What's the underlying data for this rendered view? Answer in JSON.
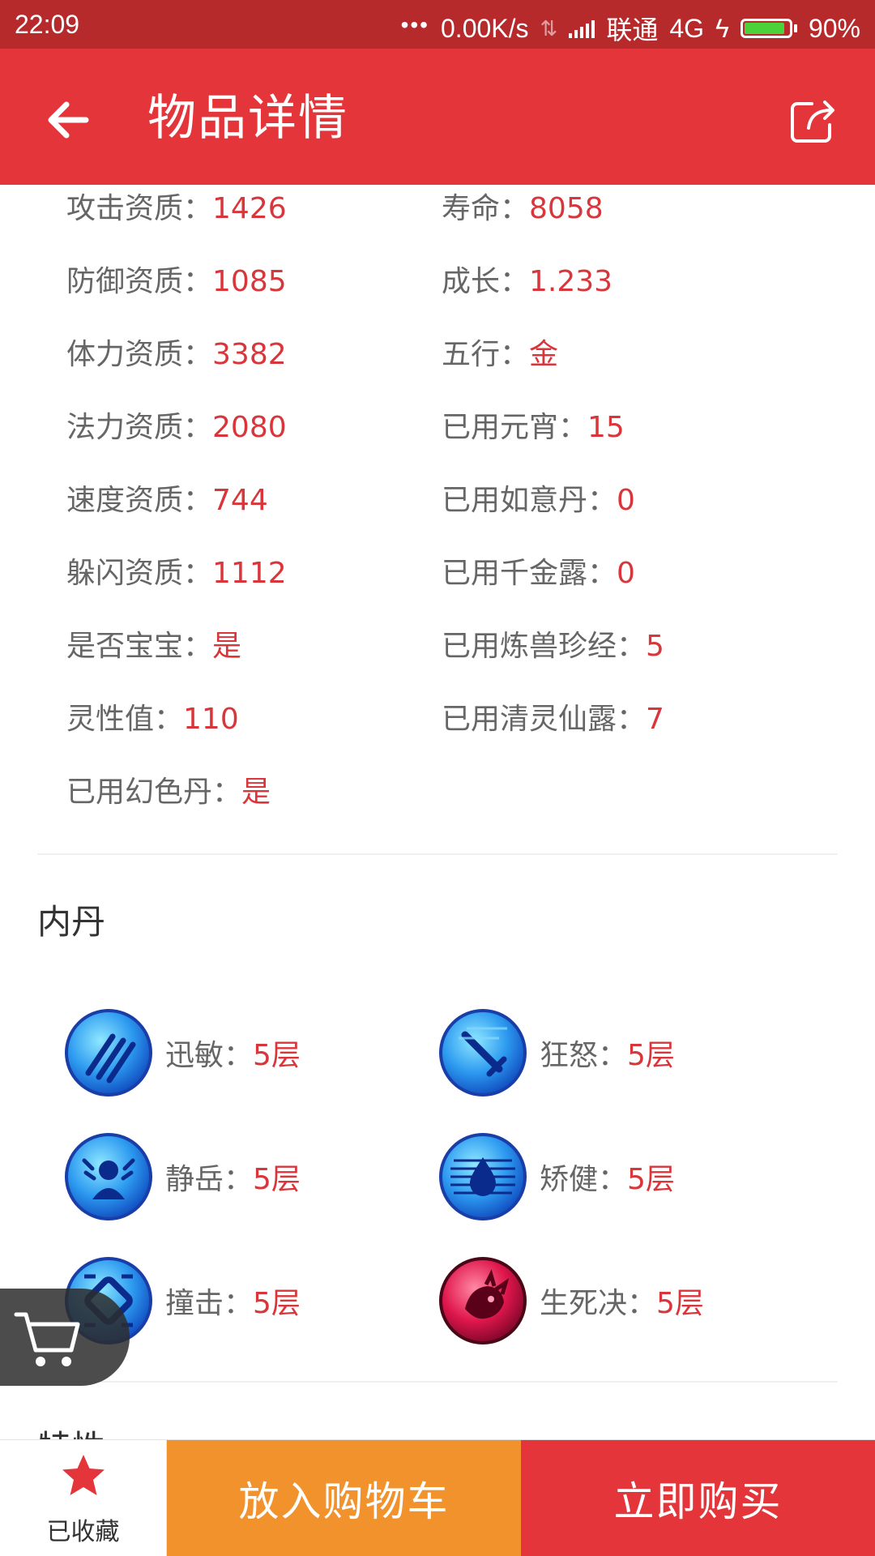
{
  "status_bar": {
    "time": "22:09",
    "speed": "0.00K/s",
    "carrier": "联通",
    "network": "4G",
    "battery": "90%",
    "battery_level": 0.9
  },
  "header": {
    "title": "物品详情",
    "back_icon": "back-arrow-icon",
    "share_icon": "share-icon"
  },
  "attributes": {
    "left": [
      {
        "label": "攻击资质：",
        "value": "1426"
      },
      {
        "label": "防御资质：",
        "value": "1085"
      },
      {
        "label": "体力资质：",
        "value": "3382"
      },
      {
        "label": "法力资质：",
        "value": "2080"
      },
      {
        "label": "速度资质：",
        "value": "744"
      },
      {
        "label": "躲闪资质：",
        "value": "1112"
      },
      {
        "label": "是否宝宝：",
        "value": "是"
      },
      {
        "label": "灵性值：",
        "value": "110"
      },
      {
        "label": "已用幻色丹：",
        "value": "是"
      }
    ],
    "right": [
      {
        "label": "寿命：",
        "value": "8058"
      },
      {
        "label": "成长：",
        "value": "1.233"
      },
      {
        "label": "五行：",
        "value": "金"
      },
      {
        "label": "已用元宵：",
        "value": "15"
      },
      {
        "label": "已用如意丹：",
        "value": "0"
      },
      {
        "label": "已用千金露：",
        "value": "0"
      },
      {
        "label": "已用炼兽珍经：",
        "value": "5"
      },
      {
        "label": "已用清灵仙露：",
        "value": "7"
      }
    ]
  },
  "neidan": {
    "title": "内丹",
    "items": [
      {
        "name": "迅敏：",
        "level": "5层",
        "icon": "claw-icon"
      },
      {
        "name": "狂怒：",
        "level": "5层",
        "icon": "sword-icon"
      },
      {
        "name": "静岳：",
        "level": "5层",
        "icon": "figure-icon"
      },
      {
        "name": "矫健：",
        "level": "5层",
        "icon": "water-drop-icon"
      },
      {
        "name": "撞击：",
        "level": "5层",
        "icon": "shield-ring-icon"
      },
      {
        "name": "生死决：",
        "level": "5层",
        "icon": "beast-icon"
      }
    ]
  },
  "next_section": {
    "title": "特性"
  },
  "bottom_bar": {
    "favorite_label": "已收藏",
    "add_to_cart_label": "放入购物车",
    "buy_now_label": "立即购买"
  },
  "colors": {
    "status_bar": "#b72a2c",
    "primary": "#e3353a",
    "value_text": "#d9363b",
    "cart_button": "#f2922c"
  }
}
